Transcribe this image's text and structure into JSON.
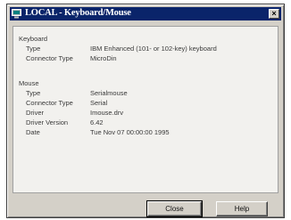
{
  "window": {
    "title": "LOCAL - Keyboard/Mouse",
    "close_glyph": "×"
  },
  "keyboard": {
    "heading": "Keyboard",
    "fields": [
      {
        "label": "Type",
        "value": "IBM Enhanced (101- or 102-key) keyboard"
      },
      {
        "label": "Connector Type",
        "value": "MicroDin"
      }
    ]
  },
  "mouse": {
    "heading": "Mouse",
    "fields": [
      {
        "label": "Type",
        "value": "Serialmouse"
      },
      {
        "label": "Connector Type",
        "value": "Serial"
      },
      {
        "label": "Driver",
        "value": "Imouse.drv"
      },
      {
        "label": "Driver Version",
        "value": "6.42"
      },
      {
        "label": "Date",
        "value": "Tue Nov 07 00:00:00 1995"
      }
    ]
  },
  "buttons": {
    "close": "Close",
    "help": "Help"
  }
}
